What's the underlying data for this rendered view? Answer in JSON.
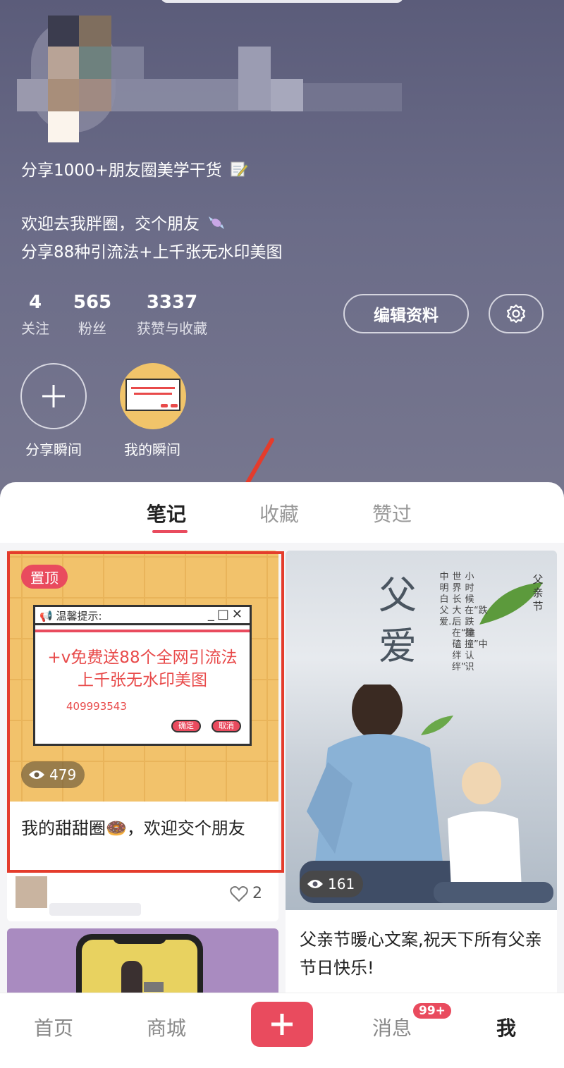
{
  "profile": {
    "bio_line1": "分享1000+朋友圈美学干货",
    "bio_line2": "欢迎去我胖圈，交个朋友",
    "bio_line3": "分享88种引流法+上千张无水印美图",
    "stats": [
      {
        "value": "4",
        "label": "关注"
      },
      {
        "value": "565",
        "label": "粉丝"
      },
      {
        "value": "3337",
        "label": "获赞与收藏"
      }
    ],
    "edit_button": "编辑资料",
    "moments": {
      "share_label": "分享瞬间",
      "mine_label": "我的瞬间"
    }
  },
  "tabs": [
    "笔记",
    "收藏",
    "赞过"
  ],
  "notes": [
    {
      "pinned": "置顶",
      "dialog": {
        "title": "温馨提示:",
        "line1": "+v免费送88个全网引流法",
        "line2": "上千张无水印美图",
        "number": "409993543",
        "ok": "确定",
        "cancel": "取消"
      },
      "views": "479",
      "title": "我的甜甜圈🍩，欢迎交个朋友",
      "likes": "2"
    },
    {
      "cover_text": "父爱",
      "cover_small": [
        "父",
        "亲",
        "节"
      ],
      "cover_poem": [
        "小时候在“跌跌撞撞”中认识",
        "世界长大后在“磕磕绊绊”",
        "中明白父爱…"
      ],
      "views": "161",
      "title": "父亲节暖心文案,祝天下所有父亲节日快乐!"
    }
  ],
  "bottom_nav": {
    "home": "首页",
    "mall": "商城",
    "messages": "消息",
    "messages_badge": "99+",
    "me": "我"
  },
  "colors": {
    "accent": "#e94b5e",
    "highlight_frame": "#e43c2c"
  }
}
